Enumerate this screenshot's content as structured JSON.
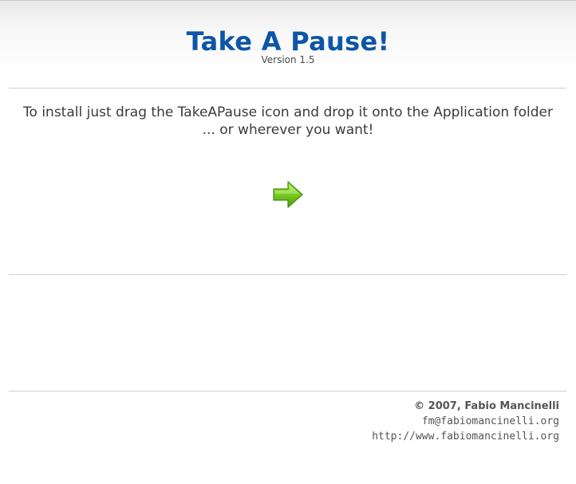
{
  "header": {
    "title": "Take A Pause!",
    "version": "Version 1.5"
  },
  "main": {
    "instruction_line1": "To install just drag the TakeAPause icon and drop it onto the Application folder",
    "instruction_line2": "... or wherever you want!",
    "arrow_icon": "right-arrow-icon",
    "arrow_color": "#6cc51a"
  },
  "footer": {
    "copyright": "© 2007, Fabio Mancinelli",
    "email": "fm@fabiomancinelli.org",
    "website": "http://www.fabiomancinelli.org"
  },
  "colors": {
    "title": "#0d56a6",
    "text": "#3b3b3b",
    "divider": "#cfcfcf"
  }
}
